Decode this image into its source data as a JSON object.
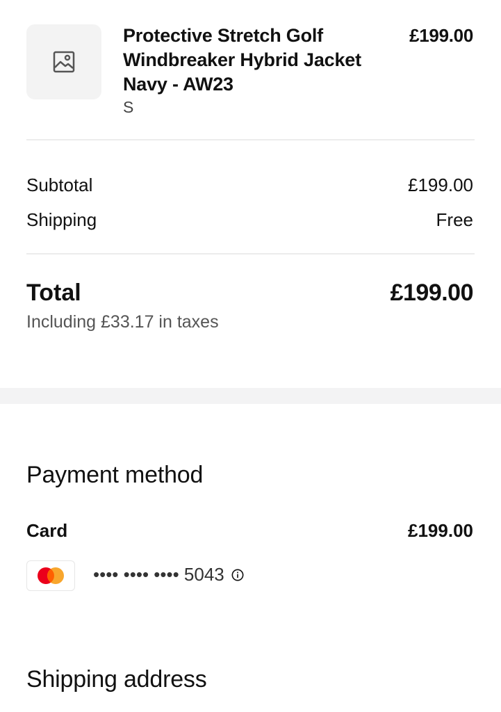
{
  "order_item": {
    "name": "Protective Stretch Golf Windbreaker Hybrid Jacket Navy - AW23",
    "variant": "S",
    "price": "£199.00",
    "thumbnail_icon": "image-placeholder-icon"
  },
  "summary": {
    "subtotal_label": "Subtotal",
    "subtotal_value": "£199.00",
    "shipping_label": "Shipping",
    "shipping_value": "Free",
    "total_label": "Total",
    "total_value": "£199.00",
    "tax_note": "Including £33.17 in taxes"
  },
  "payment": {
    "title": "Payment method",
    "method_label": "Card",
    "amount": "£199.00",
    "card_brand_icon": "mastercard-icon",
    "card_mask": "•••• •••• •••• 5043",
    "info_icon": "info-icon"
  },
  "shipping_address": {
    "title": "Shipping address"
  },
  "colors": {
    "text": "#111111",
    "muted": "#555555",
    "divider": "#ececec",
    "band": "#f3f3f4",
    "mastercard_red": "#eb001b",
    "mastercard_orange": "#f79e1b"
  }
}
